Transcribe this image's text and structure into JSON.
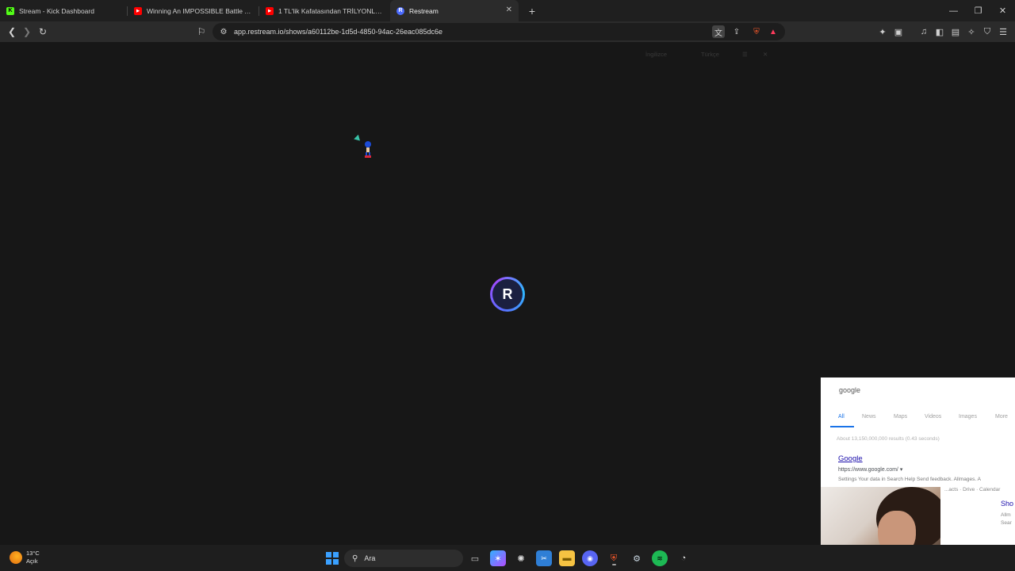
{
  "browser": {
    "tabs": [
      {
        "title": "Stream - Kick Dashboard",
        "fav_color": "#53fc18",
        "fav_glyph": "K"
      },
      {
        "title": "Winning An IMPOSSIBLE Battle As Sp",
        "fav_color": "#ff0000",
        "fav_glyph": "▶"
      },
      {
        "title": "1 TL'lik Kafatasından TRİLYONLUK MI",
        "fav_color": "#ff0000",
        "fav_glyph": "▶"
      },
      {
        "title": "Restream",
        "fav_color": "#4b6bff",
        "fav_glyph": "R"
      }
    ],
    "address": "app.restream.io/shows/a60112be-1d5d-4850-94ac-26eac085dc6e",
    "translate": {
      "lang1": "İngilizce",
      "lang2": "Türkçe"
    }
  },
  "page": {
    "logo_letter": "R"
  },
  "overlay": {
    "search_query": "google",
    "tabs": [
      "All",
      "News",
      "Maps",
      "Videos",
      "Images",
      "More"
    ],
    "stats": "About 13,150,000,000 results (0.43 seconds)",
    "result_title": "Google",
    "result_url": "https://www.google.com/ ▾",
    "snippet": "Settings Your data in Search Help Send feedback. Allmages. A",
    "links": "...acts · Drive · Calendar",
    "side_title": "Sho",
    "side_text": "Allm\nSear"
  },
  "taskbar": {
    "weather_temp": "13°C",
    "weather_desc": "Açık",
    "search_label": "Ara"
  }
}
